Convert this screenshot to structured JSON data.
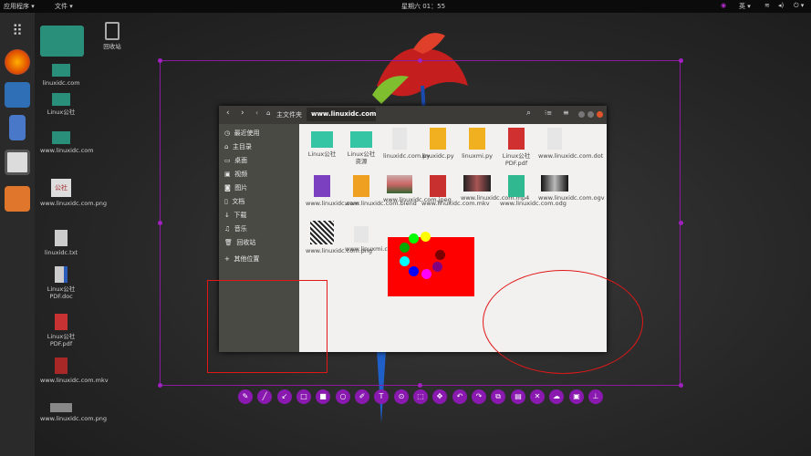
{
  "topbar": {
    "apps_menu": "应用程序 ▾",
    "places_menu": "文件 ▾",
    "clock": "星期六 01：55",
    "lang": "英 ▾"
  },
  "desktop": {
    "icons": [
      {
        "label": "",
        "icon": "folder-icon"
      },
      {
        "label": "回收站",
        "icon": "trash-icon"
      },
      {
        "label": "linuxidc.com",
        "icon": "folder-icon"
      },
      {
        "label": "Linux公社",
        "icon": "folder-icon"
      },
      {
        "label": "www.linuxidc.com",
        "icon": "folder-icon"
      },
      {
        "label": "www.linuxidc.com.png",
        "icon": "image-file-icon"
      },
      {
        "label": "linuxidc.txt",
        "icon": "text-file-icon"
      },
      {
        "label": "Linux公社PDF.doc",
        "icon": "doc-file-icon"
      },
      {
        "label": "Linux公社PDF.pdf",
        "icon": "pdf-file-icon"
      },
      {
        "label": "www.linuxidc.com.mkv",
        "icon": "video-file-icon"
      },
      {
        "label": "www.linuxidc.com.png",
        "icon": "image-file-icon"
      }
    ]
  },
  "filemanager": {
    "path_home": "主文件夹",
    "path_current": "www.linuxidc.com",
    "sidebar": [
      "最近使用",
      "主目录",
      "桌面",
      "视频",
      "图片",
      "文档",
      "下载",
      "音乐",
      "回收站",
      "其他位置"
    ],
    "files": [
      {
        "label": "Linux公社",
        "icon": "folder-icon"
      },
      {
        "label": "Linux公社资源",
        "icon": "folder-icon"
      },
      {
        "label": "linuxidc.com.py",
        "icon": "blank-file-icon"
      },
      {
        "label": "linuxidc.py",
        "icon": "python-file-icon"
      },
      {
        "label": "linuxmi.py",
        "icon": "python-file-icon"
      },
      {
        "label": "Linux公社PDF.pdf",
        "icon": "pdf-file-icon"
      },
      {
        "label": "www.linuxidc.com.dot",
        "icon": "blank-file-icon"
      },
      {
        "label": "www.linuxidc.com",
        "icon": "code-file-icon"
      },
      {
        "label": "www.linuxidc.com.blend",
        "icon": "blend-file-icon"
      },
      {
        "label": "www.linuxidc.com.jpeg",
        "icon": "photo-thumbnail-icon"
      },
      {
        "label": "www.linuxidc.com.mkv",
        "icon": "video-file-icon"
      },
      {
        "label": "www.linuxidc.com.mp4",
        "icon": "video-thumbnail-icon"
      },
      {
        "label": "www.linuxidc.com.odg",
        "icon": "drawing-file-icon"
      },
      {
        "label": "www.linuxidc.com.ogv",
        "icon": "video-thumbnail-icon"
      },
      {
        "label": "www.linuxidc.com.png",
        "icon": "qr-thumbnail-icon"
      },
      {
        "label": "www.linuxmi.com.txt",
        "icon": "blank-file-icon"
      }
    ]
  },
  "annotation_toolbar": {
    "tools": [
      "pen-icon",
      "line-icon",
      "arrow-icon",
      "rectangle-icon",
      "filled-rectangle-icon",
      "circle-icon",
      "marker-icon",
      "text-icon",
      "blur-icon",
      "select-icon",
      "move-icon",
      "undo-icon",
      "redo-icon",
      "copy-icon",
      "save-icon",
      "close-icon",
      "upload-icon",
      "open-app-icon",
      "pin-icon"
    ]
  },
  "colors": {
    "accent": "#8a19b0",
    "annotation_red": "#ff0000",
    "folder": "#2fbf9f",
    "palette": [
      "#ffff00",
      "#ff0000",
      "#7a0000",
      "#800080",
      "#ff00ff",
      "#0000ff",
      "#00ffff",
      "#00aa00",
      "#00ff00"
    ]
  }
}
